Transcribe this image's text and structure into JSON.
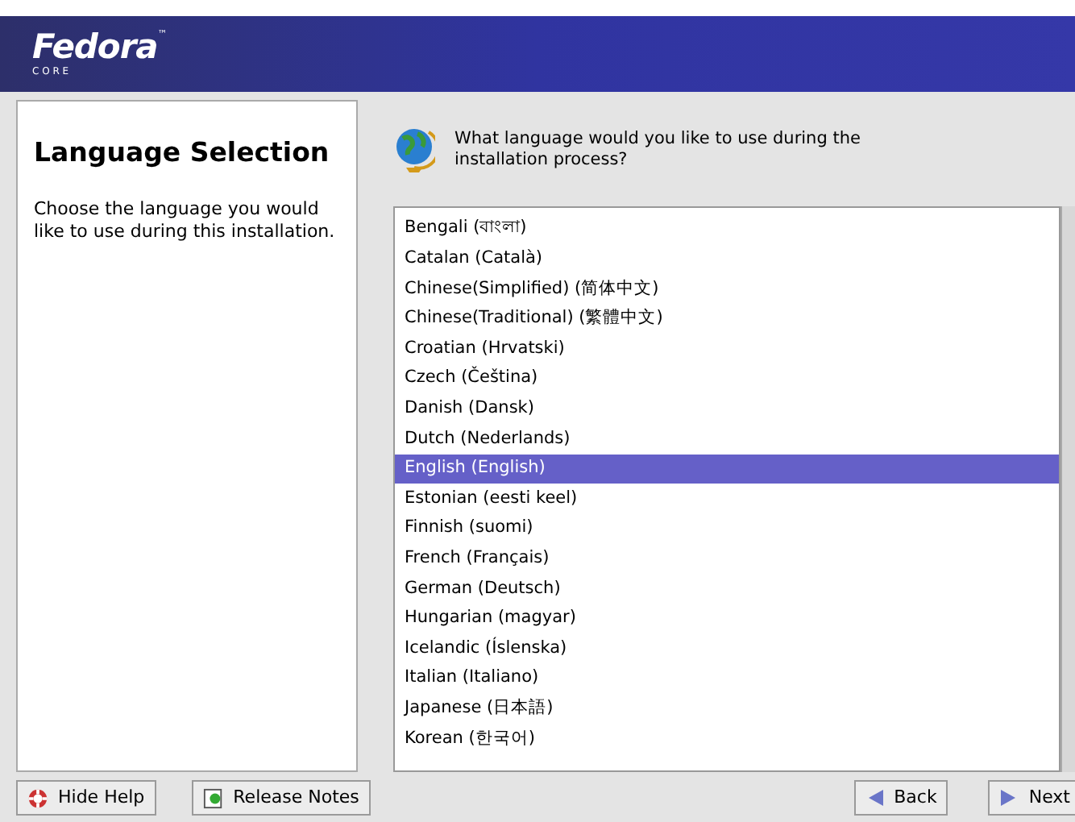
{
  "header": {
    "logo": "Fedora",
    "logo_sub": "C O R E",
    "trademark": "™"
  },
  "help": {
    "title": "Language Selection",
    "text": "Choose the language you would like to use during this installation."
  },
  "question": "What language would you like to use during the installation process?",
  "languages": [
    {
      "label": "Bengali (বাংলা)",
      "selected": false
    },
    {
      "label": "Catalan (Català)",
      "selected": false
    },
    {
      "label": "Chinese(Simplified) (简体中文)",
      "selected": false
    },
    {
      "label": "Chinese(Traditional) (繁體中文)",
      "selected": false
    },
    {
      "label": "Croatian (Hrvatski)",
      "selected": false
    },
    {
      "label": "Czech (Čeština)",
      "selected": false
    },
    {
      "label": "Danish (Dansk)",
      "selected": false
    },
    {
      "label": "Dutch (Nederlands)",
      "selected": false
    },
    {
      "label": "English (English)",
      "selected": true
    },
    {
      "label": "Estonian (eesti keel)",
      "selected": false
    },
    {
      "label": "Finnish (suomi)",
      "selected": false
    },
    {
      "label": "French (Français)",
      "selected": false
    },
    {
      "label": "German (Deutsch)",
      "selected": false
    },
    {
      "label": "Hungarian (magyar)",
      "selected": false
    },
    {
      "label": "Icelandic (Íslenska)",
      "selected": false
    },
    {
      "label": "Italian (Italiano)",
      "selected": false
    },
    {
      "label": "Japanese (日本語)",
      "selected": false
    },
    {
      "label": "Korean (한국어)",
      "selected": false
    }
  ],
  "buttons": [
    {
      "kind": "help",
      "label": "Hide Help"
    },
    {
      "kind": "notes",
      "label": "Release Notes"
    },
    {
      "kind": "back",
      "label": "Back"
    },
    {
      "kind": "next",
      "label": "Next"
    }
  ]
}
